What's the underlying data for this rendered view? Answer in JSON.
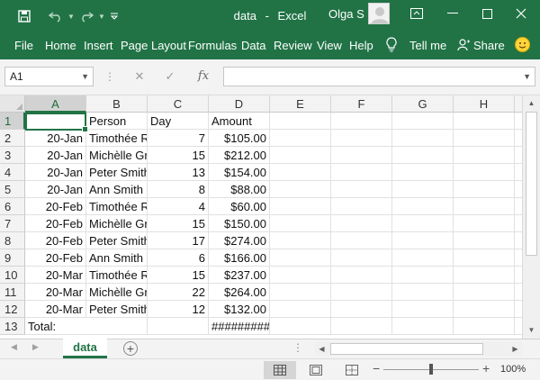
{
  "window": {
    "doc_name": "data",
    "separator": "-",
    "app_name": "Excel",
    "user": "Olga S"
  },
  "ribbon_tabs": [
    "File",
    "Home",
    "Insert",
    "Page Layout",
    "Formulas",
    "Data",
    "Review",
    "View",
    "Help"
  ],
  "ribbon_extras": {
    "tell_me": "Tell me",
    "share": "Share"
  },
  "formula_bar": {
    "name_box": "A1",
    "fx_label": "fx",
    "cancel_glyph": "✕",
    "confirm_glyph": "✓",
    "content": ""
  },
  "columns": [
    "A",
    "B",
    "C",
    "D",
    "E",
    "F",
    "G",
    "H"
  ],
  "rows": [
    [
      "",
      "Person",
      "Day",
      "Amount"
    ],
    [
      "20-Jan",
      "Timothée R",
      "7",
      "$105.00"
    ],
    [
      "20-Jan",
      "Michèlle Gr",
      "15",
      "$212.00"
    ],
    [
      "20-Jan",
      "Peter Smith",
      "13",
      "$154.00"
    ],
    [
      "20-Jan",
      "Ann Smith",
      "8",
      "$88.00"
    ],
    [
      "20-Feb",
      "Timothée R",
      "4",
      "$60.00"
    ],
    [
      "20-Feb",
      "Michèlle Gr",
      "15",
      "$150.00"
    ],
    [
      "20-Feb",
      "Peter Smith",
      "17",
      "$274.00"
    ],
    [
      "20-Feb",
      "Ann Smith",
      "6",
      "$166.00"
    ],
    [
      "20-Mar",
      "Timothée R",
      "15",
      "$237.00"
    ],
    [
      "20-Mar",
      "Michèlle Gr",
      "22",
      "$264.00"
    ],
    [
      "20-Mar",
      "Peter Smith",
      "12",
      "$132.00"
    ],
    [
      "Total:",
      "",
      "",
      "#########"
    ]
  ],
  "row_numbers": [
    "1",
    "2",
    "3",
    "4",
    "5",
    "6",
    "7",
    "8",
    "9",
    "10",
    "11",
    "12",
    "13"
  ],
  "sheet": {
    "active_tab": "data",
    "add_glyph": "+"
  },
  "status": {
    "zoom": "100%",
    "zoom_minus": "−",
    "zoom_plus": "+"
  },
  "colors": {
    "accent": "#217346",
    "title_bar": "#217346"
  }
}
